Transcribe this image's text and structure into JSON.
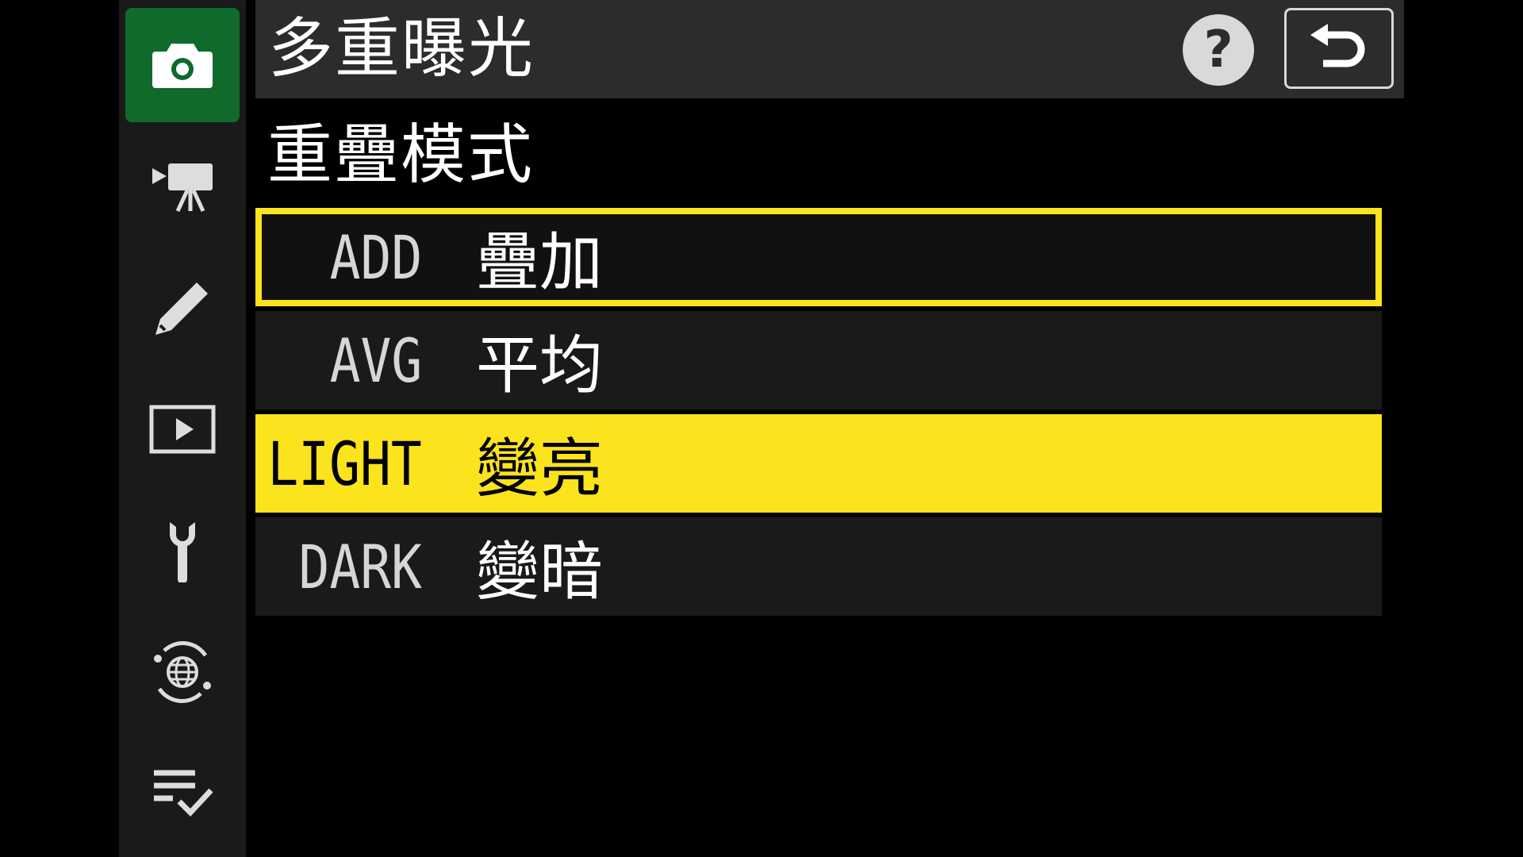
{
  "header": {
    "title": "多重曝光",
    "help_label": "?"
  },
  "subtitle": "重疊模式",
  "sidebar": {
    "items": [
      {
        "icon": "camera-icon",
        "active": true
      },
      {
        "icon": "movie-camera-icon",
        "active": false
      },
      {
        "icon": "pencil-icon",
        "active": false
      },
      {
        "icon": "playback-icon",
        "active": false
      },
      {
        "icon": "wrench-icon",
        "active": false
      },
      {
        "icon": "network-globe-icon",
        "active": false
      },
      {
        "icon": "my-menu-checklist-icon",
        "active": false
      }
    ]
  },
  "options": [
    {
      "code": "ADD",
      "label": "疊加",
      "state": "outlined"
    },
    {
      "code": "AVG",
      "label": "平均",
      "state": "normal"
    },
    {
      "code": "LIGHT",
      "label": "變亮",
      "state": "selected"
    },
    {
      "code": "DARK",
      "label": "變暗",
      "state": "normal"
    }
  ],
  "colors": {
    "highlight": "#fbe31d",
    "active_tab": "#0f6a2c",
    "header_bg": "#2c2c2c",
    "row_bg": "#1a1a1a"
  }
}
